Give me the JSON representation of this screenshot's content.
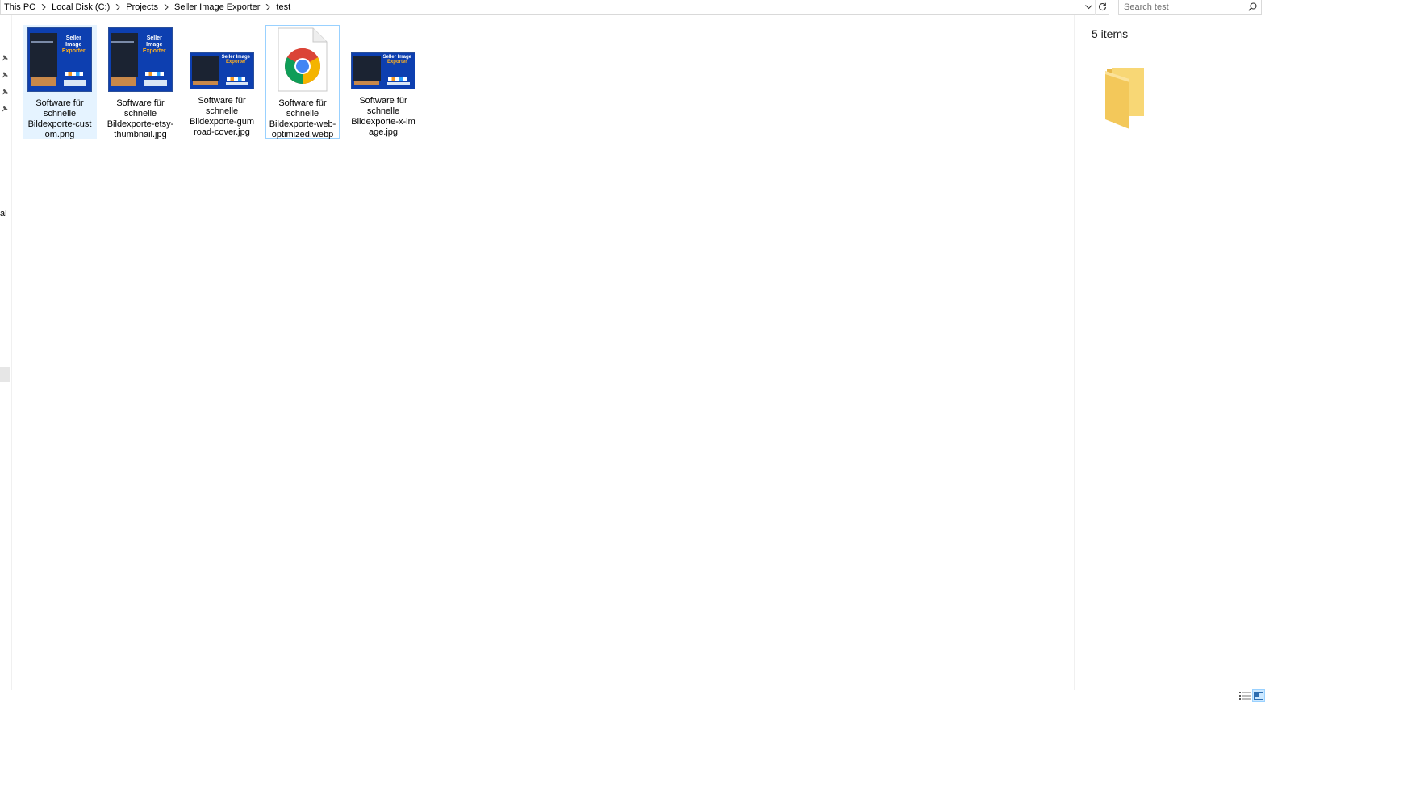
{
  "address_bar": {
    "breadcrumbs": [
      "This PC",
      "Local Disk (C:)",
      "Projects",
      "Seller Image Exporter",
      "test"
    ]
  },
  "search": {
    "placeholder": "Search test"
  },
  "nav_pane": {
    "partial_label": "al"
  },
  "files": [
    {
      "name": "Software für\nschnelle\nBildexporte-cust\nom.png",
      "kind": "image",
      "shape": "square",
      "state": "selected"
    },
    {
      "name": "Software für\nschnelle\nBildexporte-etsy-\nthumbnail.jpg",
      "kind": "image",
      "shape": "square",
      "state": "normal"
    },
    {
      "name": "Software für\nschnelle\nBildexporte-gum\nroad-cover.jpg",
      "kind": "image",
      "shape": "wide",
      "state": "normal"
    },
    {
      "name": "Software für\nschnelle\nBildexporte-web-\noptimized.webp",
      "kind": "chrome-document",
      "shape": "document",
      "state": "focused"
    },
    {
      "name": "Software für\nschnelle\nBildexporte-x-im\nage.jpg",
      "kind": "image",
      "shape": "wide",
      "state": "normal"
    }
  ],
  "thumbnail_text": {
    "line1": "Seller Image",
    "line2": "Exporter"
  },
  "preview_pane": {
    "item_count": "5 items",
    "icon": "folder-icon"
  },
  "view_buttons": [
    {
      "name": "details-view-button",
      "active": false
    },
    {
      "name": "large-icons-view-button",
      "active": true
    }
  ],
  "colors": {
    "selection": "#e5f3ff",
    "focus_border": "#99d1ff",
    "folder": "#f8d775"
  }
}
